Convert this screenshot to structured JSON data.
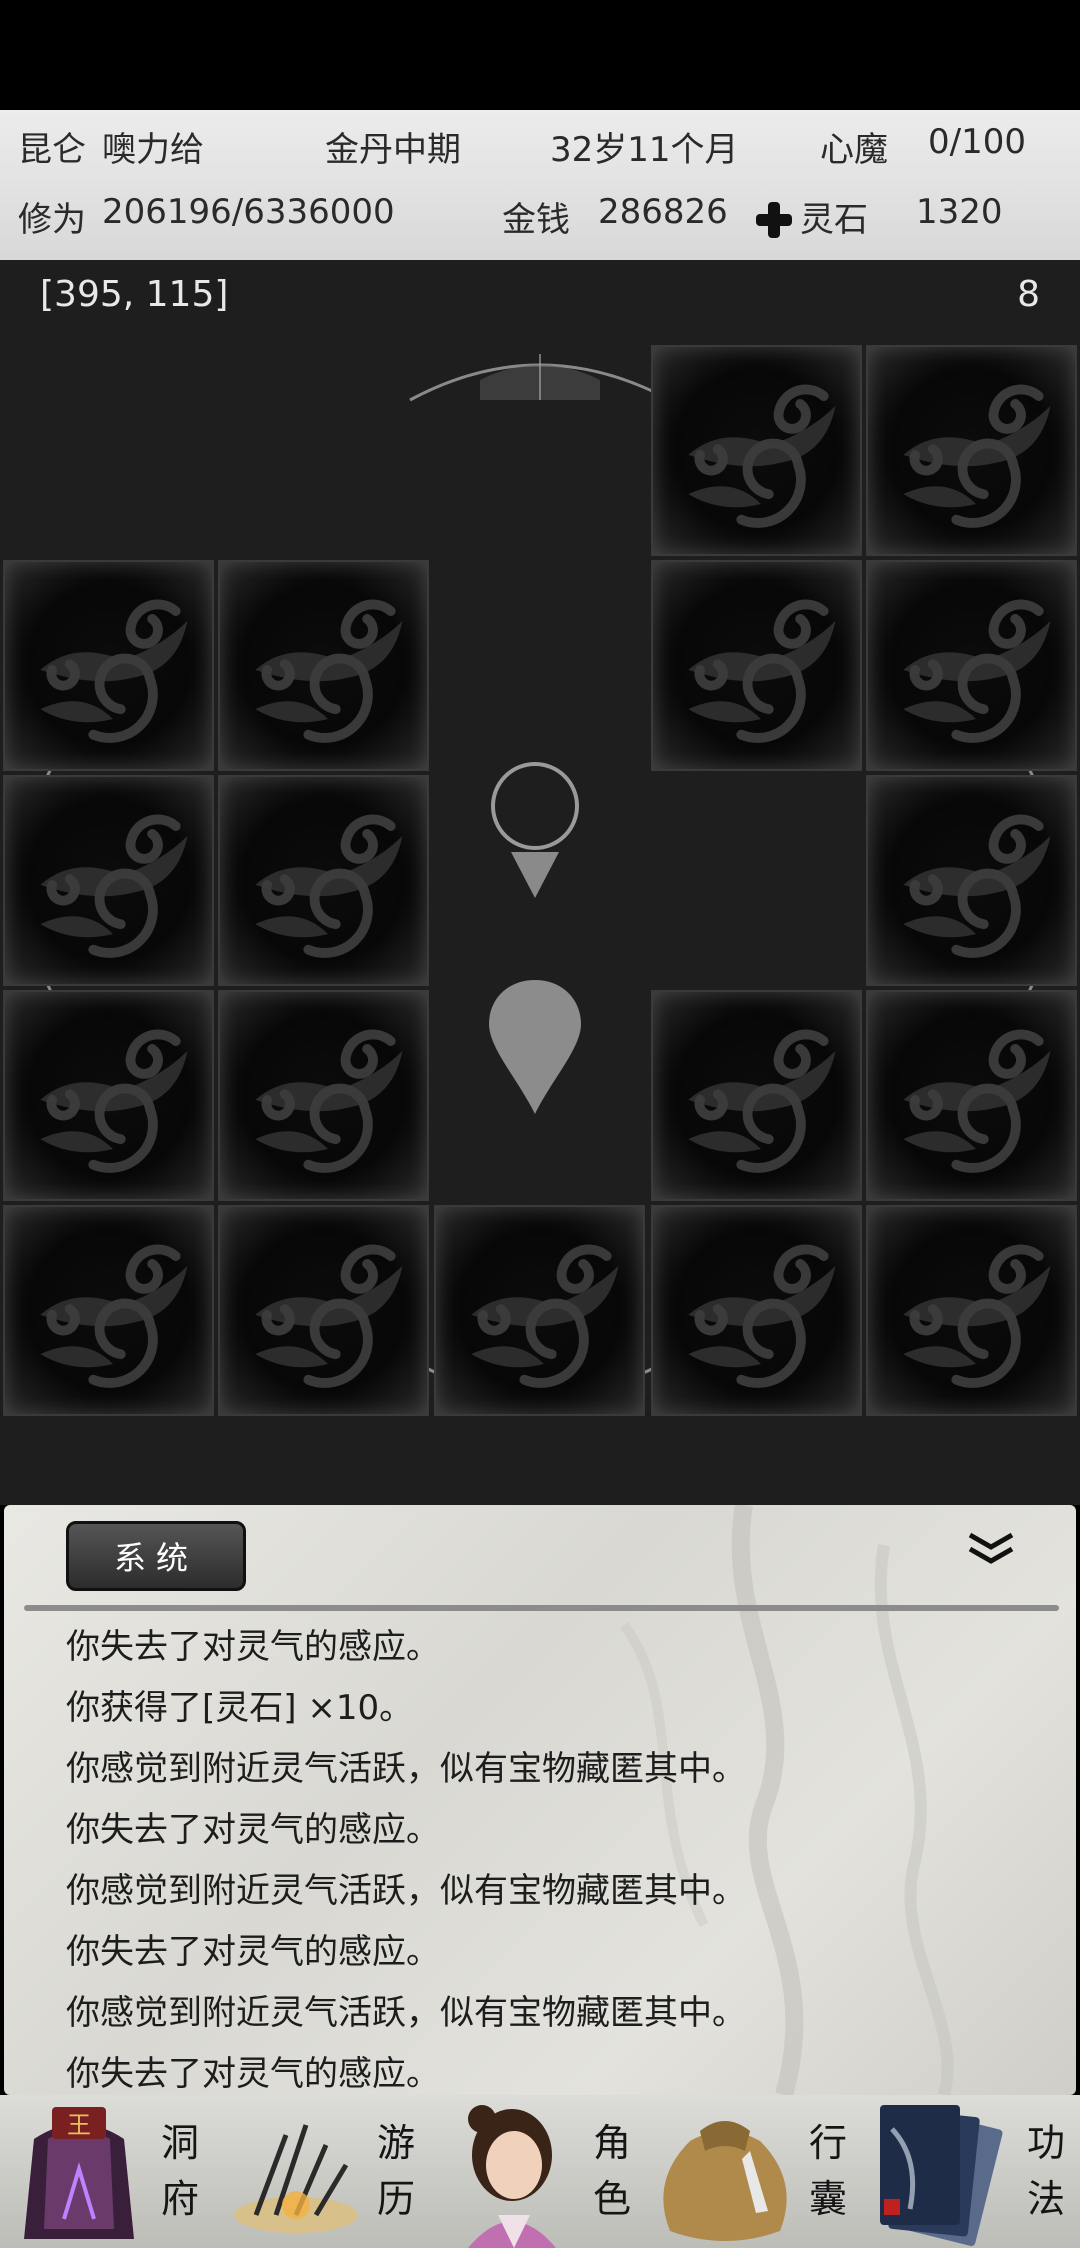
{
  "status": {
    "sect": "昆仑",
    "name": "噢力给",
    "realm": "金丹中期",
    "age": "32岁11个月",
    "demon_label": "心魔",
    "demon_value": "0/100",
    "cultivation_label": "修为",
    "cultivation_value": "206196/6336000",
    "money_label": "金钱",
    "money_value": "286826",
    "stone_label": "灵石",
    "stone_value": "1320"
  },
  "map": {
    "coords": "[395, 115]",
    "steps": "8"
  },
  "log": {
    "tab_label": "系统",
    "lines": [
      "你失去了对灵气的感应。",
      "你获得了[灵石] ×10。",
      "你感觉到附近灵气活跃，似有宝物藏匿其中。",
      "你失去了对灵气的感应。",
      "你感觉到附近灵气活跃，似有宝物藏匿其中。",
      "你失去了对灵气的感应。",
      "你感觉到附近灵气活跃，似有宝物藏匿其中。",
      "你失去了对灵气的感应。"
    ]
  },
  "nav": {
    "items": [
      {
        "top": "洞",
        "bottom": "府",
        "icon": "cave-icon"
      },
      {
        "top": "游",
        "bottom": "历",
        "icon": "travel-icon"
      },
      {
        "top": "角",
        "bottom": "色",
        "icon": "character-icon"
      },
      {
        "top": "行",
        "bottom": "囊",
        "icon": "bag-icon"
      },
      {
        "top": "功",
        "bottom": "法",
        "icon": "skill-book-icon"
      }
    ]
  }
}
